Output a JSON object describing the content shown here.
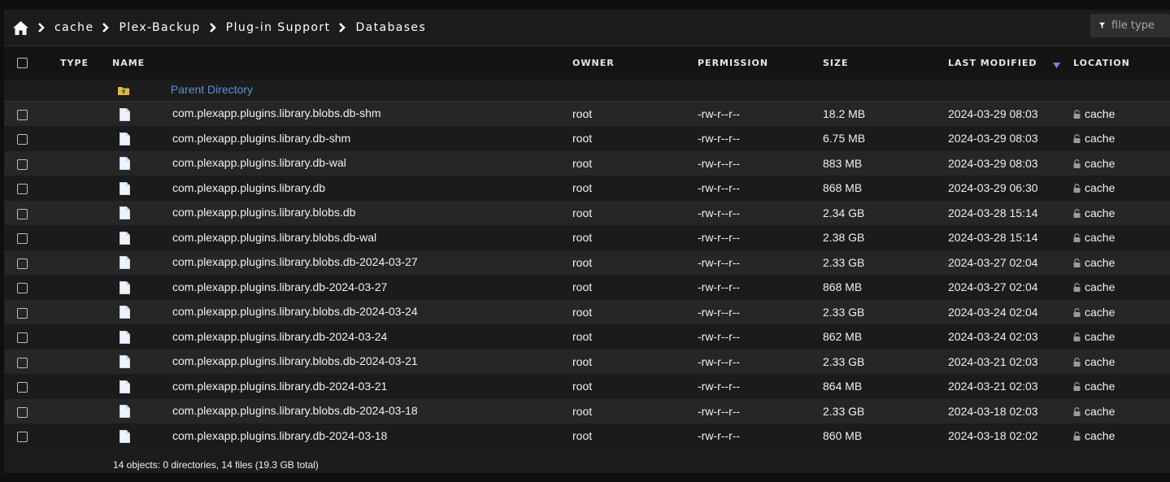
{
  "breadcrumb": [
    "cache",
    "Plex-Backup",
    "Plug-in Support",
    "Databases"
  ],
  "filter": {
    "placeholder": "file type"
  },
  "columns": {
    "type": "TYPE",
    "name": "NAME",
    "owner": "OWNER",
    "permission": "PERMISSION",
    "size": "SIZE",
    "last_modified": "LAST MODIFIED",
    "location": "LOCATION"
  },
  "parent": {
    "label": "Parent Directory"
  },
  "files": [
    {
      "name": "com.plexapp.plugins.library.blobs.db-shm",
      "owner": "root",
      "permission": "-rw-r--r--",
      "size": "18.2 MB",
      "modified": "2024-03-29 08:03",
      "location": "cache"
    },
    {
      "name": "com.plexapp.plugins.library.db-shm",
      "owner": "root",
      "permission": "-rw-r--r--",
      "size": "6.75 MB",
      "modified": "2024-03-29 08:03",
      "location": "cache"
    },
    {
      "name": "com.plexapp.plugins.library.db-wal",
      "owner": "root",
      "permission": "-rw-r--r--",
      "size": "883 MB",
      "modified": "2024-03-29 08:03",
      "location": "cache"
    },
    {
      "name": "com.plexapp.plugins.library.db",
      "owner": "root",
      "permission": "-rw-r--r--",
      "size": "868 MB",
      "modified": "2024-03-29 06:30",
      "location": "cache"
    },
    {
      "name": "com.plexapp.plugins.library.blobs.db",
      "owner": "root",
      "permission": "-rw-r--r--",
      "size": "2.34 GB",
      "modified": "2024-03-28 15:14",
      "location": "cache"
    },
    {
      "name": "com.plexapp.plugins.library.blobs.db-wal",
      "owner": "root",
      "permission": "-rw-r--r--",
      "size": "2.38 GB",
      "modified": "2024-03-28 15:14",
      "location": "cache"
    },
    {
      "name": "com.plexapp.plugins.library.blobs.db-2024-03-27",
      "owner": "root",
      "permission": "-rw-r--r--",
      "size": "2.33 GB",
      "modified": "2024-03-27 02:04",
      "location": "cache"
    },
    {
      "name": "com.plexapp.plugins.library.db-2024-03-27",
      "owner": "root",
      "permission": "-rw-r--r--",
      "size": "868 MB",
      "modified": "2024-03-27 02:04",
      "location": "cache"
    },
    {
      "name": "com.plexapp.plugins.library.blobs.db-2024-03-24",
      "owner": "root",
      "permission": "-rw-r--r--",
      "size": "2.33 GB",
      "modified": "2024-03-24 02:04",
      "location": "cache"
    },
    {
      "name": "com.plexapp.plugins.library.db-2024-03-24",
      "owner": "root",
      "permission": "-rw-r--r--",
      "size": "862 MB",
      "modified": "2024-03-24 02:03",
      "location": "cache"
    },
    {
      "name": "com.plexapp.plugins.library.blobs.db-2024-03-21",
      "owner": "root",
      "permission": "-rw-r--r--",
      "size": "2.33 GB",
      "modified": "2024-03-21 02:03",
      "location": "cache"
    },
    {
      "name": "com.plexapp.plugins.library.db-2024-03-21",
      "owner": "root",
      "permission": "-rw-r--r--",
      "size": "864 MB",
      "modified": "2024-03-21 02:03",
      "location": "cache"
    },
    {
      "name": "com.plexapp.plugins.library.blobs.db-2024-03-18",
      "owner": "root",
      "permission": "-rw-r--r--",
      "size": "2.33 GB",
      "modified": "2024-03-18 02:03",
      "location": "cache"
    },
    {
      "name": "com.plexapp.plugins.library.db-2024-03-18",
      "owner": "root",
      "permission": "-rw-r--r--",
      "size": "860 MB",
      "modified": "2024-03-18 02:02",
      "location": "cache"
    }
  ],
  "summary": "14 objects: 0 directories, 14 files (19.3 GB total)",
  "icons": {
    "home": "home-icon",
    "breadcrumb_separator": "chevron-right-icon",
    "filter": "funnel-icon",
    "sort_name": "sort-asc-icon",
    "sort_modified": "sort-desc-icon",
    "parent": "folder-up-icon",
    "file": "file-icon",
    "location": "lock-icon"
  },
  "colors": {
    "background": "#1c1c1c",
    "header": "#141414",
    "row_alt": "#262626",
    "link": "#5b8fd9",
    "sort_indicator": "#7b7fe6",
    "folder": "#e0b941"
  }
}
